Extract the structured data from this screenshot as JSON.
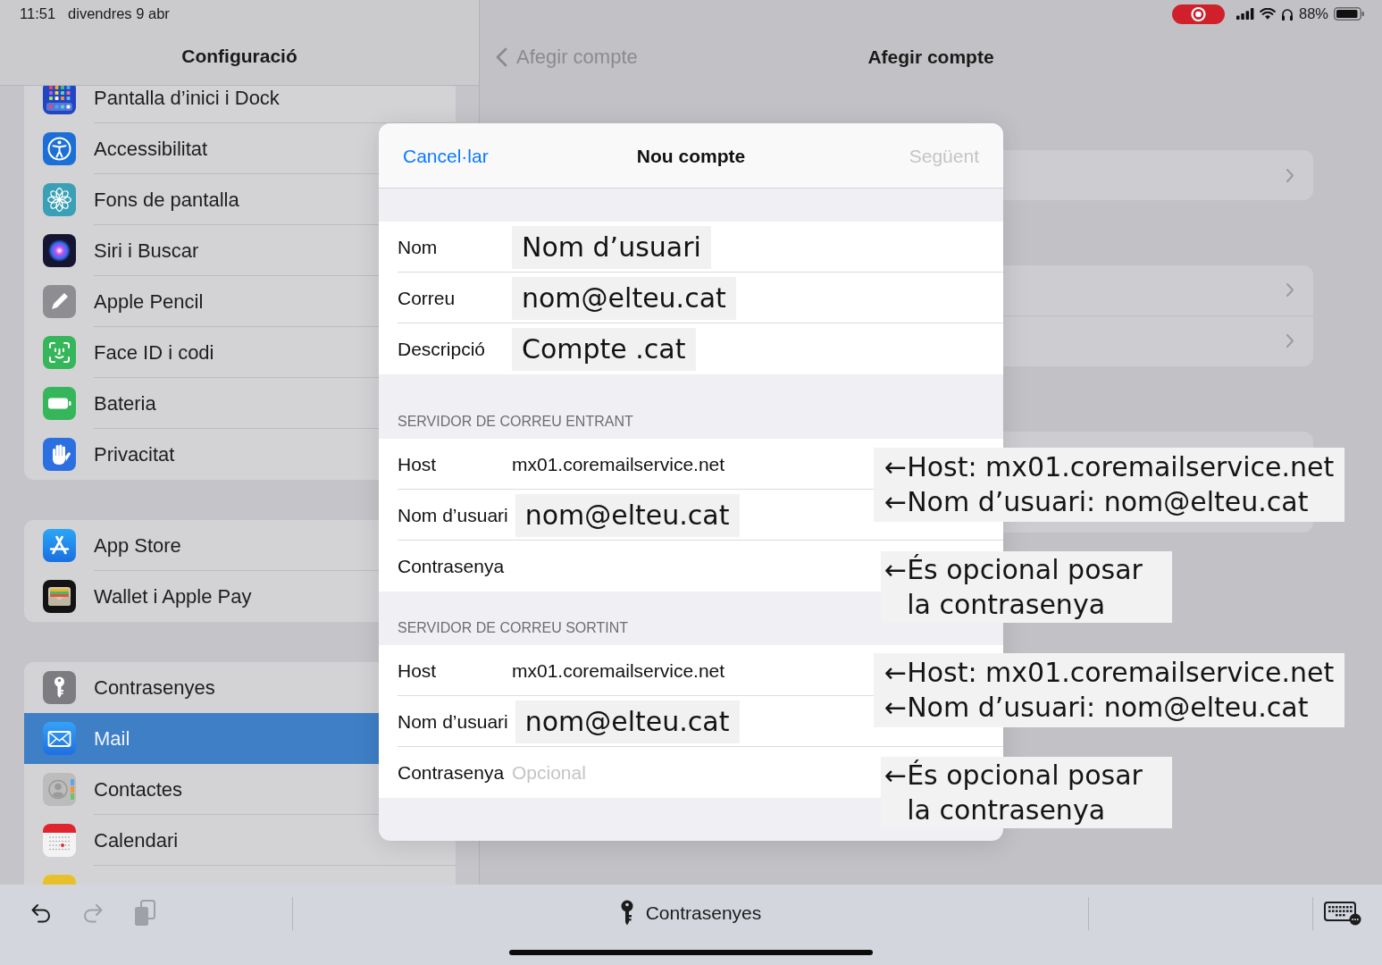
{
  "status_bar": {
    "time": "11:51",
    "date": "divendres 9 abr",
    "recording": true,
    "battery": "88%"
  },
  "sidebar": {
    "title": "Configuració",
    "groups": [
      {
        "items": [
          {
            "kind": "home",
            "label": "Pantalla d’inici i Dock",
            "selected": false
          },
          {
            "kind": "accessibility",
            "label": "Accessibilitat",
            "selected": false
          },
          {
            "kind": "wallpaper",
            "label": "Fons de pantalla",
            "selected": false
          },
          {
            "kind": "siri",
            "label": "Siri i Buscar",
            "selected": false
          },
          {
            "kind": "pencil",
            "label": "Apple Pencil",
            "selected": false
          },
          {
            "kind": "faceid",
            "label": "Face ID i codi",
            "selected": false
          },
          {
            "kind": "battery",
            "label": "Bateria",
            "selected": false
          },
          {
            "kind": "privacy",
            "label": "Privacitat",
            "selected": false
          }
        ]
      },
      {
        "items": [
          {
            "kind": "appstore",
            "label": "App Store",
            "selected": false
          },
          {
            "kind": "wallet",
            "label": "Wallet i Apple Pay",
            "selected": false
          }
        ]
      },
      {
        "items": [
          {
            "kind": "passwords",
            "label": "Contrasenyes",
            "selected": false
          },
          {
            "kind": "mail",
            "label": "Mail",
            "selected": true
          },
          {
            "kind": "contacts",
            "label": "Contactes",
            "selected": false
          },
          {
            "kind": "calendar",
            "label": "Calendari",
            "selected": false
          },
          {
            "kind": "notes",
            "selected": false
          }
        ]
      }
    ]
  },
  "detail": {
    "back": "Afegir compte",
    "title": "Afegir compte"
  },
  "dialog": {
    "cancel": "Cancel·lar",
    "title": "Nou compte",
    "next": {
      "label": "Següent",
      "disabled": true
    },
    "sections": [
      {
        "rows": [
          {
            "label": "Nom",
            "value": "Nom d’usuari",
            "highlighted": true
          },
          {
            "label": "Correu",
            "value": "nom@elteu.cat",
            "highlighted": true
          },
          {
            "label": "Descripció",
            "value": "Compte .cat",
            "highlighted": true
          }
        ]
      },
      {
        "header": "SERVIDOR DE CORREU ENTRANT",
        "rows": [
          {
            "label": "Host",
            "value": "mx01.coremailservice.net",
            "highlighted": false
          },
          {
            "label": "Nom d’usuari",
            "value": "nom@elteu.cat",
            "highlighted": true
          },
          {
            "label": "Contrasenya",
            "highlighted": false
          }
        ]
      },
      {
        "header": "SERVIDOR DE CORREU SORTINT",
        "rows": [
          {
            "label": "Host",
            "value": "mx01.coremailservice.net",
            "highlighted": false
          },
          {
            "label": "Nom d’usuari",
            "value": "nom@elteu.cat",
            "highlighted": true
          },
          {
            "label": "Contrasenya",
            "placeholder": "Opcional",
            "highlighted": false
          }
        ]
      }
    ]
  },
  "callouts": [
    {
      "lines": [
        "←Host: mx01.coremailservice.net",
        "←Nom d’usuari: nom@elteu.cat"
      ]
    },
    {
      "lines": [
        "←És opcional posar la contrasenya"
      ]
    },
    {
      "lines": [
        "←Host: mx01.coremailservice.net",
        "←Nom d’usuari: nom@elteu.cat"
      ]
    },
    {
      "lines": [
        "←És opcional posar la contrasenya"
      ]
    }
  ],
  "shortcut_bar": {
    "buttons": [
      {
        "kind": "undo",
        "disabled": false
      },
      {
        "kind": "redo",
        "disabled": true
      },
      {
        "kind": "paste",
        "disabled": true
      }
    ],
    "suggestion": "Contrasenyes"
  }
}
